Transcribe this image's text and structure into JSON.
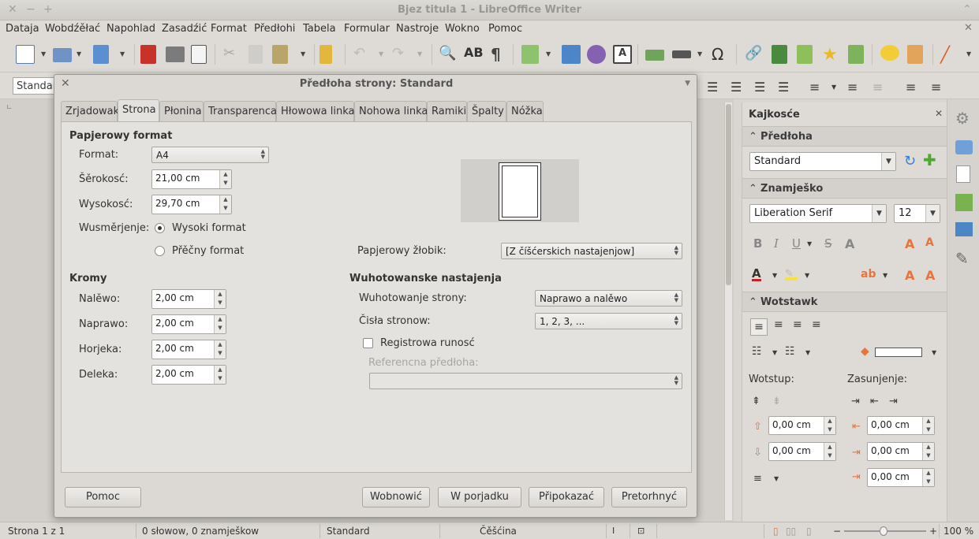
{
  "window": {
    "title": "Bjez titula 1 - LibreOffice Writer"
  },
  "menu": [
    "Dataja",
    "Wobdźěłać",
    "Napohlad",
    "Zasadźić",
    "Format",
    "Předłohi",
    "Tabela",
    "Formular",
    "Nastroje",
    "Wokno",
    "Pomoc"
  ],
  "formatbar": {
    "style_value": "Standard"
  },
  "dialog": {
    "title": "Předłoha strony: Standard",
    "tabs": [
      "Zrjadowak",
      "Strona",
      "Płonina",
      "Transparenca",
      "Hłowowa linka",
      "Nohowa linka",
      "Ramiki",
      "Špalty",
      "Nóžka"
    ],
    "active_tab": "Strona",
    "paper": {
      "heading": "Papjerowy format",
      "format_label": "Format:",
      "format_value": "A4",
      "width_label": "Šěrokosć:",
      "width_value": "21,00 cm",
      "height_label": "Wysokosć:",
      "height_value": "29,70 cm",
      "orientation_label": "Wusměrjenje:",
      "portrait_label": "Wysoki format",
      "landscape_label": "Přěčny format",
      "tray_label": "Papjerowy žłobik:",
      "tray_value": "[Z číšćerskich nastajenjow]"
    },
    "margins": {
      "heading": "Kromy",
      "left_label": "Nalěwo:",
      "left_value": "2,00 cm",
      "right_label": "Naprawo:",
      "right_value": "2,00 cm",
      "top_label": "Horjeka:",
      "top_value": "2,00 cm",
      "bottom_label": "Deleka:",
      "bottom_value": "2,00 cm"
    },
    "layout": {
      "heading": "Wuhotowanske nastajenja",
      "page_layout_label": "Wuhotowanje strony:",
      "page_layout_value": "Naprawo a nalěwo",
      "numbers_label": "Čisła stronow:",
      "numbers_value": "1, 2, 3, ...",
      "register_label": "Registrowa runosć",
      "ref_style_label": "Referencna předłoha:",
      "ref_style_value": ""
    },
    "buttons": {
      "help": "Pomoc",
      "reset": "Wobnowić",
      "ok": "W porjadku",
      "apply": "Připokazać",
      "cancel": "Pretorhnyć"
    }
  },
  "sidebar": {
    "title": "Kajkosće",
    "style_section": "Předłoha",
    "style_value": "Standard",
    "char_section": "Znamješko",
    "font_value": "Liberation Serif",
    "size_value": "12",
    "para_section": "Wotstawk",
    "indent_label": "Wotstup:",
    "spacing_label": "Zasunjenje:",
    "spin1": "0,00 cm",
    "spin2": "0,00 cm",
    "spin3": "0,00 cm",
    "spin4": "0,00 cm",
    "spin5": "0,00 cm"
  },
  "statusbar": {
    "page": "Strona 1 z 1",
    "words": "0 słowow, 0 znamješkow",
    "style": "Standard",
    "language": "Čěšćina",
    "zoom": "100 %"
  },
  "colors": {
    "accent": "#e8743b",
    "dialog_bg": "#dcd9d4",
    "panel_bg": "#e4e2de"
  }
}
